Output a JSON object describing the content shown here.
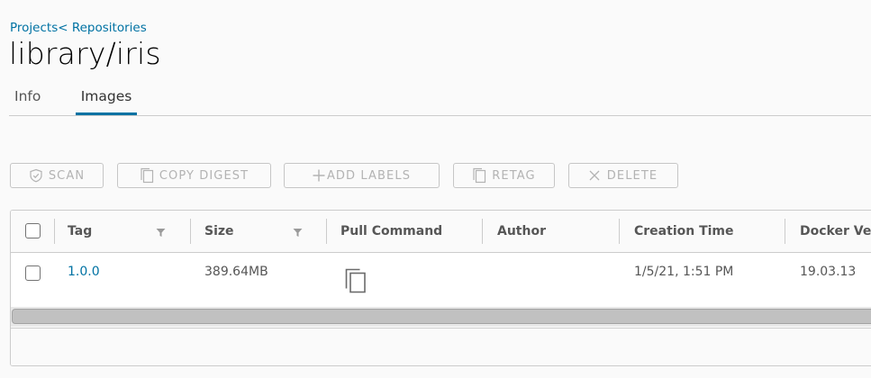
{
  "breadcrumb": {
    "projects": "Projects",
    "separator": "< ",
    "repositories": "Repositories"
  },
  "page": {
    "title": "library/iris"
  },
  "tabs": [
    {
      "label": "Info",
      "active": false
    },
    {
      "label": "Images",
      "active": true
    }
  ],
  "toolbar": {
    "scan": "SCAN",
    "copy_digest": "COPY DIGEST",
    "add_labels": "ADD LABELS",
    "retag": "RETAG",
    "delete": "DELETE"
  },
  "table": {
    "columns": [
      "Tag",
      "Size",
      "Pull Command",
      "Author",
      "Creation Time",
      "Docker Ver"
    ],
    "rows": [
      {
        "tag": "1.0.0",
        "size": "389.64MB",
        "pull_command_icon": "copy-icon",
        "author": "",
        "creation_time": "1/5/21, 1:51 PM",
        "docker_version": "19.03.13"
      }
    ]
  },
  "colors": {
    "accent": "#0072a3",
    "border": "#cccccc",
    "disabled_text": "#b3b3b3"
  }
}
